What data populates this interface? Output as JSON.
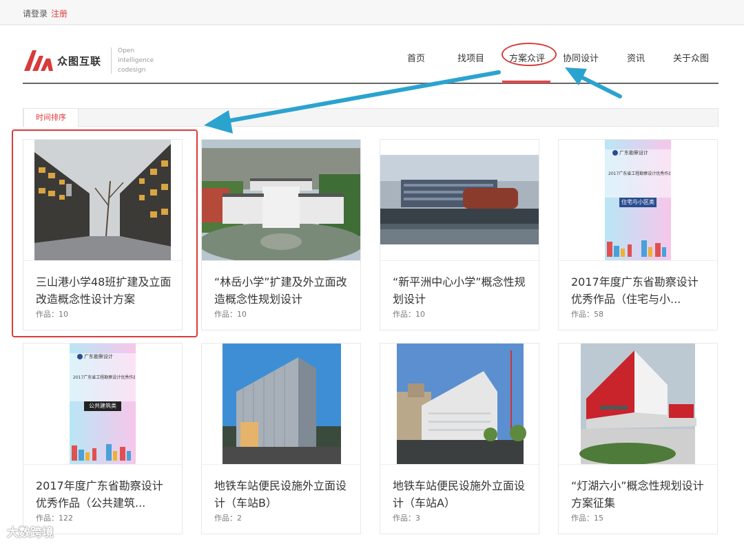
{
  "topbar": {
    "login": "请登录",
    "register": "注册"
  },
  "logo": {
    "name": "众图互联",
    "sub": [
      "Open",
      "intelligence",
      "codesign"
    ]
  },
  "nav": [
    {
      "label": "首页"
    },
    {
      "label": "找项目"
    },
    {
      "label": "方案众评"
    },
    {
      "label": "协同设计"
    },
    {
      "label": "资讯"
    },
    {
      "label": "关于众图"
    }
  ],
  "tabs": [
    {
      "label": "时间排序"
    }
  ],
  "cards": [
    {
      "title": "三山港小学48班扩建及立面改造概念性设计方案",
      "count": "作品：10"
    },
    {
      "title": "“林岳小学”扩建及外立面改造概念性规划设计",
      "count": "作品：10"
    },
    {
      "title": "“新平洲中心小学”概念性规划设计",
      "count": "作品：10"
    },
    {
      "title": "2017年度广东省勘察设计优秀作品（住宅与小...",
      "count": "作品：58"
    },
    {
      "title": "2017年度广东省勘察设计优秀作品（公共建筑...",
      "count": "作品：122"
    },
    {
      "title": "地铁车站便民设施外立面设计（车站B）",
      "count": "作品：2"
    },
    {
      "title": "地铁车站便民设施外立面设计（车站A）",
      "count": "作品：3"
    },
    {
      "title": "“灯湖六小”概念性规划设计方案征集",
      "count": "作品：15"
    }
  ],
  "posters": {
    "a": {
      "header": "广东勘察设计",
      "line": "2017广东省工程勘察设计优秀作品展",
      "label": "住宅与小区类"
    },
    "b": {
      "header": "广东勘察设计",
      "line": "2017广东省工程勘察设计优秀作品展",
      "label": "公共建筑类"
    }
  },
  "watermark": "大数跨境",
  "colors": {
    "accent": "#d94a4a",
    "annotation_arrow": "#2ba3cf"
  }
}
